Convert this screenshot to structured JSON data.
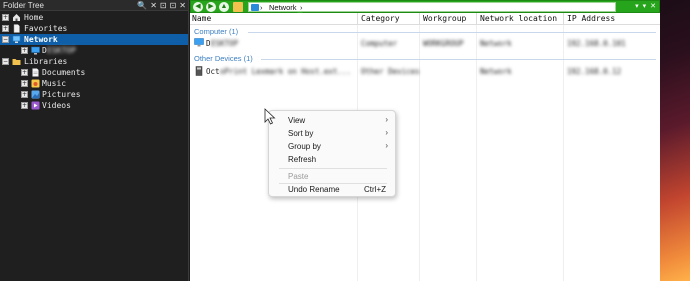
{
  "tree": {
    "title": "Folder Tree",
    "controls": [
      "🔍",
      "✕",
      "⊡",
      "⊡",
      "✕"
    ],
    "items": [
      {
        "label": "Home",
        "expander": "+",
        "icon": "home-icon"
      },
      {
        "label": "Favorites",
        "expander": "+",
        "icon": "document-icon"
      },
      {
        "label": "Network",
        "expander": "−",
        "icon": "network-icon",
        "selected": true
      },
      {
        "label": "D",
        "obscured": "ESKTOP",
        "expander": "+",
        "icon": "computer-icon",
        "blurred": true
      },
      {
        "label": "Libraries",
        "expander": "−",
        "icon": "folder-icon"
      },
      {
        "label": "Documents",
        "expander": "+",
        "icon": "documents-icon"
      },
      {
        "label": "Music",
        "expander": "+",
        "icon": "music-icon"
      },
      {
        "label": "Pictures",
        "expander": "+",
        "icon": "pictures-icon"
      },
      {
        "label": "Videos",
        "expander": "+",
        "icon": "videos-icon"
      }
    ]
  },
  "toolbar": {
    "breadcrumb_sep": "›",
    "breadcrumb": "Network",
    "breadcrumb_end": "›",
    "right_icons": [
      "▾",
      "▾",
      "✕"
    ]
  },
  "columns": {
    "name": "Name",
    "category": "Category",
    "workgroup": "Workgroup",
    "network_location": "Network location",
    "ip_address": "IP Address"
  },
  "groups": {
    "computer": "Computer (1)",
    "other": "Other Devices (1)"
  },
  "rows": {
    "computer": {
      "name_prefix": "D",
      "name_rest": "ESKTOP",
      "category": "Computer",
      "workgroup": "WORKGROUP",
      "location": "Network",
      "ip": "192.168.0.101"
    },
    "other": {
      "name_prefix": "Oct",
      "name_rest": "oPrint Lexmark on Host.ext...",
      "category": "Other Devices",
      "workgroup": "",
      "location": "Network",
      "ip": "192.168.0.12"
    }
  },
  "context_menu": {
    "view": "View",
    "sort_by": "Sort by",
    "group_by": "Group by",
    "refresh": "Refresh",
    "paste": "Paste",
    "undo_rename": "Undo Rename",
    "undo_shortcut": "Ctrl+Z",
    "arrow": "›"
  },
  "colors": {
    "toolbar_green": "#26a51c",
    "tree_selection": "#0f5fa8",
    "group_header": "#3c7fc2"
  }
}
